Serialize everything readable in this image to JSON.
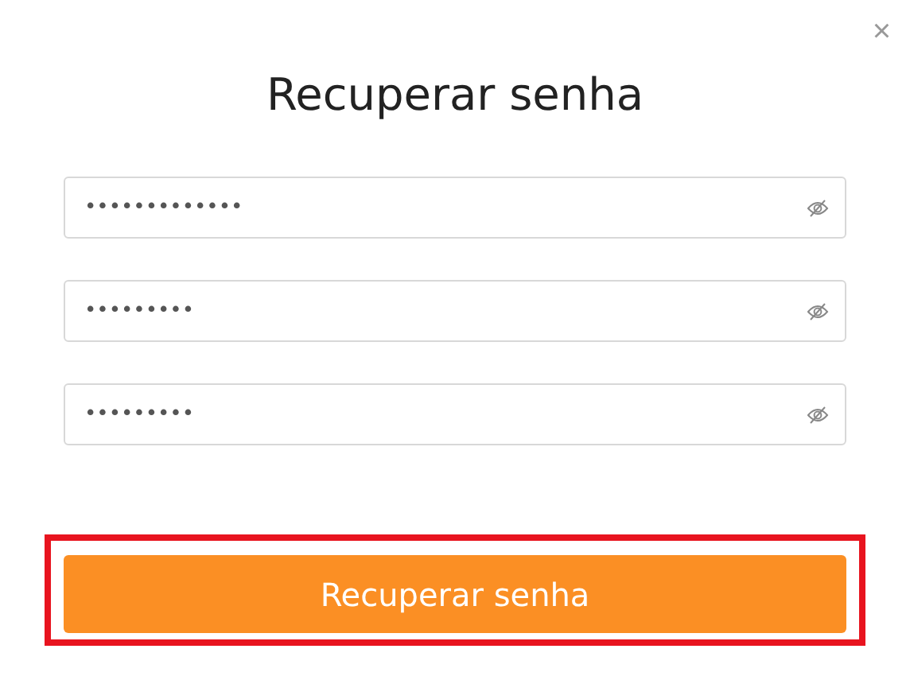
{
  "dialog": {
    "title": "Recuperar senha",
    "close": "×"
  },
  "fields": [
    {
      "value": "•••••••••••••",
      "revealed": false
    },
    {
      "value": "•••••••••",
      "revealed": false
    },
    {
      "value": "•••••••••",
      "revealed": false
    }
  ],
  "submit": {
    "label": "Recuperar senha",
    "highlighted": true
  }
}
